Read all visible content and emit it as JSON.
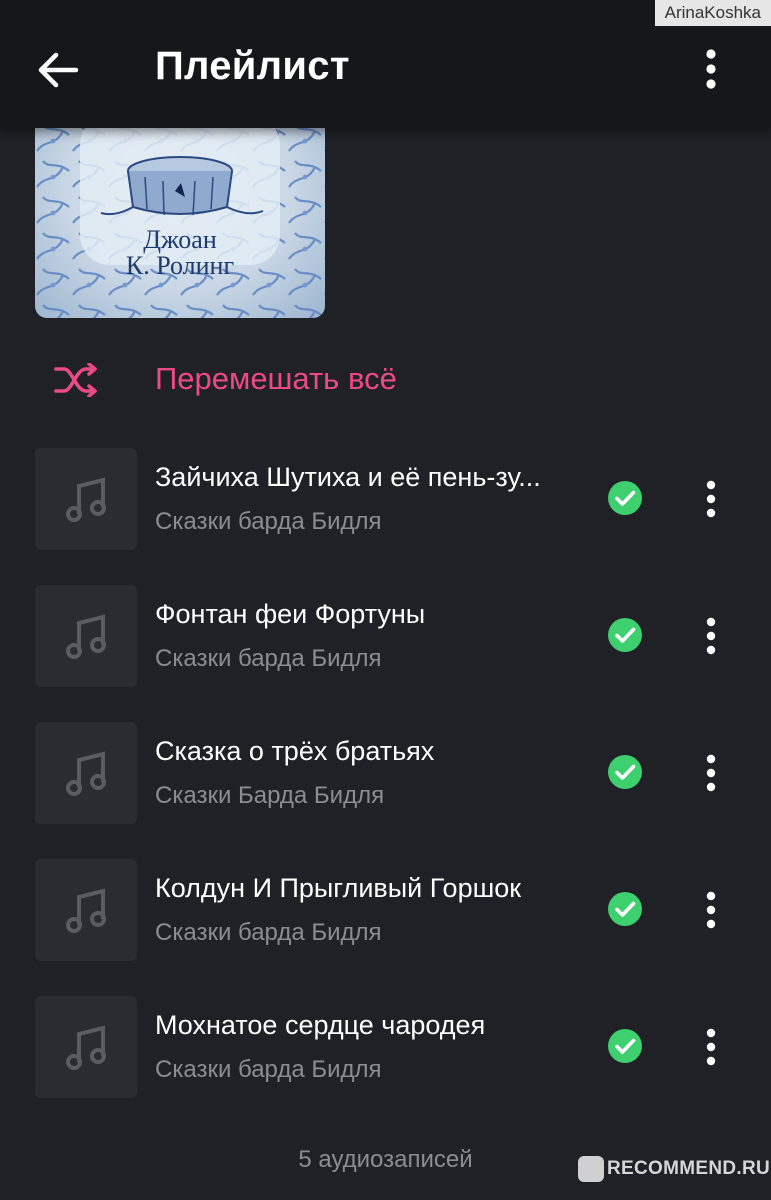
{
  "watermark": "ArinaKoshka",
  "header": {
    "title": "Плейлист",
    "back_icon": "arrow-left-icon",
    "menu_icon": "more-vertical-icon"
  },
  "cover": {
    "author_line1": "Джоан",
    "author_line2": "К. Ролинг"
  },
  "shuffle": {
    "label": "Перемешать всё",
    "icon": "shuffle-icon",
    "color": "#ec4a86"
  },
  "tracks": [
    {
      "title": "Зайчиха Шутиха и её пень-зу...",
      "artist": "Сказки барда Бидля"
    },
    {
      "title": "Фонтан феи Фортуны",
      "artist": "Сказки барда Бидля"
    },
    {
      "title": "Сказка о трёх братьях",
      "artist": "Сказки Барда Бидля"
    },
    {
      "title": "Колдун И Прыгливый Горшок",
      "artist": "Сказки барда Бидля"
    },
    {
      "title": "Мохнатое сердце чародея",
      "artist": "Сказки барда Бидля"
    }
  ],
  "track_icons": {
    "thumb": "music-note-icon",
    "status": "check-circle-icon",
    "menu": "more-vertical-icon"
  },
  "status_color": "#3ecf6e",
  "footer": {
    "count_label": "5 аудиозаписей"
  },
  "brand": {
    "text": "RECOMMEND.RU"
  }
}
